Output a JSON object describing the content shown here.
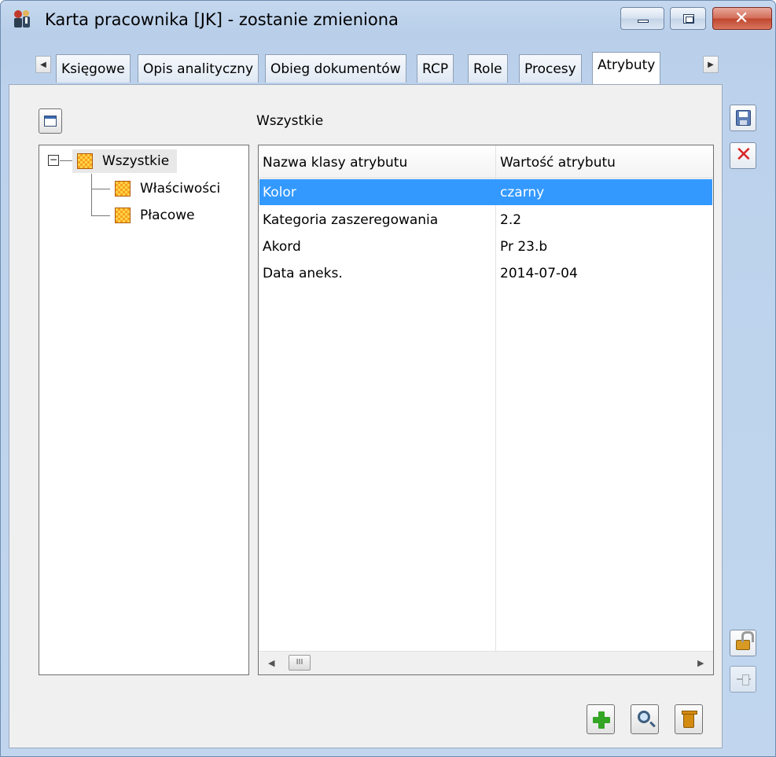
{
  "window": {
    "title": "Karta pracownika [JK] - zostanie zmieniona"
  },
  "tabs": [
    {
      "label": "Księgowe",
      "active": false
    },
    {
      "label": "Opis analityczny",
      "active": false
    },
    {
      "label": "Obieg dokumentów",
      "active": false
    },
    {
      "label": "RCP",
      "active": false
    },
    {
      "label": "Role",
      "active": false
    },
    {
      "label": "Procesy",
      "active": false
    },
    {
      "label": "Atrybuty",
      "active": true
    }
  ],
  "panel": {
    "label": "Wszystkie"
  },
  "tree": {
    "root": "Wszystkie",
    "children": [
      "Właściwości",
      "Płacowe"
    ]
  },
  "grid": {
    "columns": [
      "Nazwa klasy atrybutu",
      "Wartość atrybutu"
    ],
    "rows": [
      {
        "name": "Kolor",
        "value": "czarny",
        "selected": true
      },
      {
        "name": "Kategoria zaszeregowania",
        "value": "2.2",
        "selected": false
      },
      {
        "name": "Akord",
        "value": "Pr 23.b",
        "selected": false
      },
      {
        "name": "Data aneks.",
        "value": "2014-07-04",
        "selected": false
      }
    ]
  },
  "icons": {
    "app": "employee-icon",
    "save": "save-icon",
    "cancel": "close-icon",
    "lock": "unlock-icon",
    "pin": "pin-icon",
    "add": "plus-icon",
    "search": "magnifier-icon",
    "delete": "trash-icon"
  },
  "colors": {
    "selection": "#3399ff",
    "close_button": "#c1472f",
    "add_icon": "#35a526",
    "cancel_icon": "#d8282a"
  }
}
